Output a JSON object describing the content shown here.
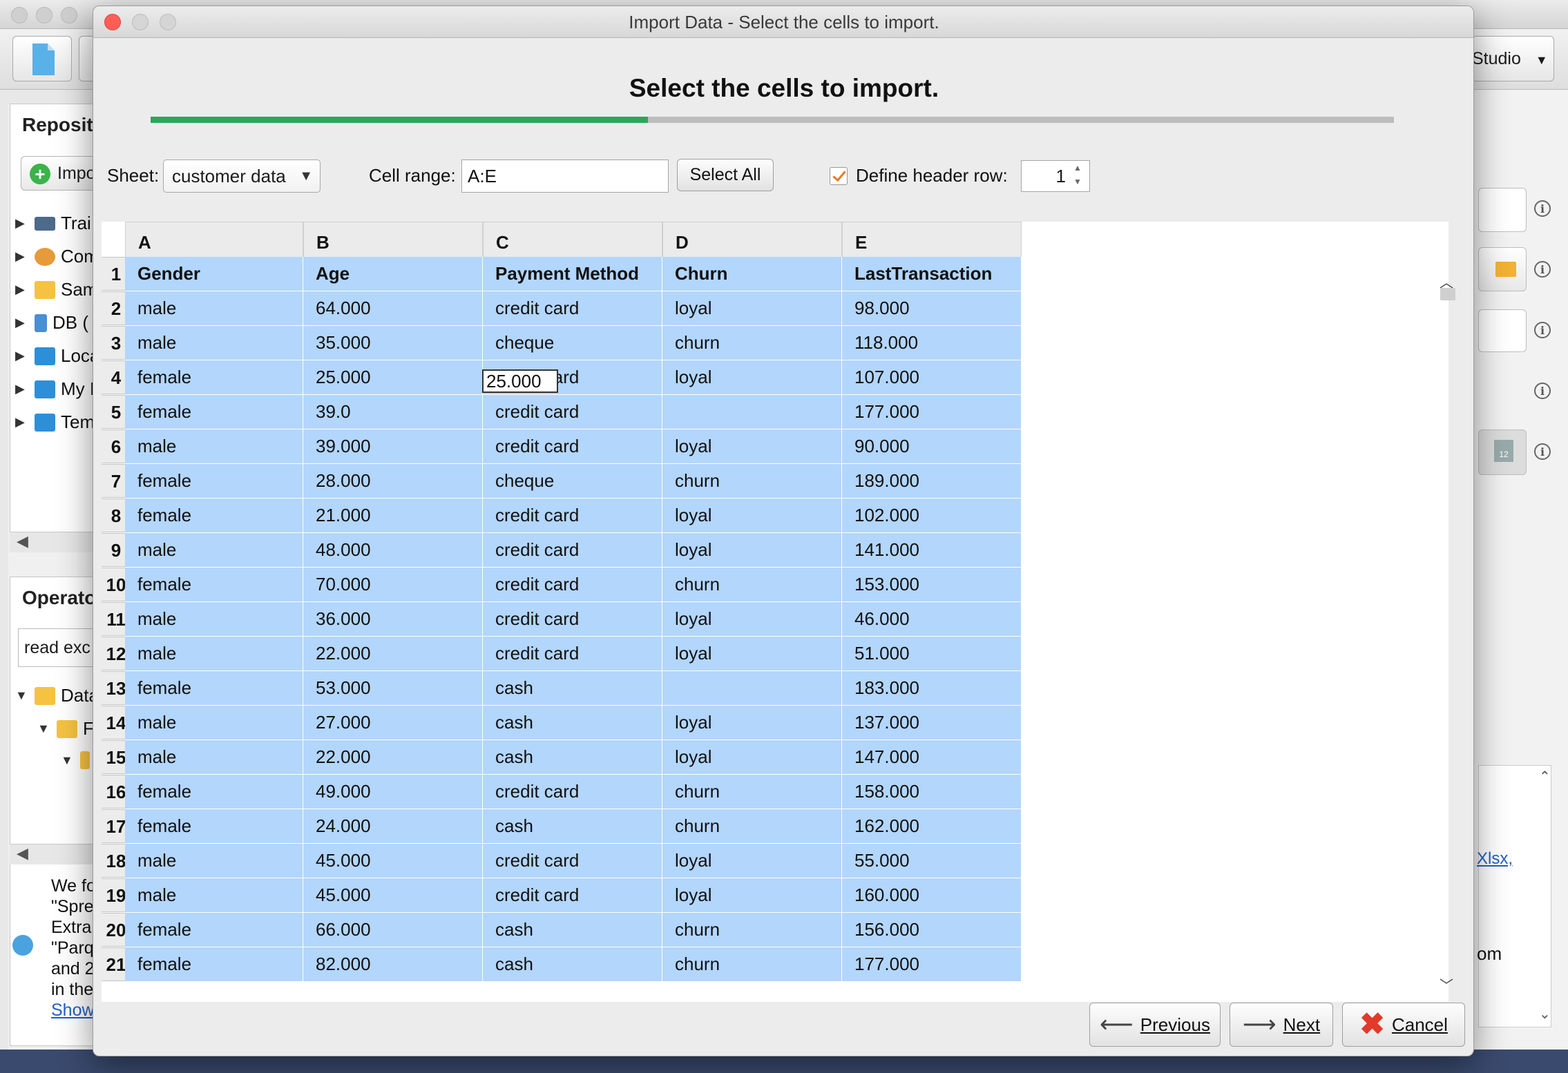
{
  "background": {
    "toolbar_right_label": "Studio",
    "repository_title": "Reposit",
    "import_button": "Impo",
    "tree_items": [
      "Trai",
      "Com",
      "Sam",
      "DB (",
      "Loca",
      "My I",
      "Tem"
    ],
    "operators_title": "Operato",
    "operators_search": "read exc",
    "operator_tree": [
      "Data",
      "F",
      ""
    ],
    "help_text": [
      "We fo",
      "\"Spre",
      "Extra",
      "\"Parq",
      "and 2",
      "in the"
    ],
    "help_link": "Show",
    "right_link": "Xlsx,",
    "right_text": "om",
    "calendar_day": "12"
  },
  "dialog": {
    "window_title": "Import Data - Select the cells to import.",
    "heading": "Select the cells to import.",
    "progress_fraction": 0.4,
    "sheet_label": "Sheet:",
    "sheet_value": "customer data",
    "cell_range_label": "Cell range:",
    "cell_range_value": "A:E",
    "select_all_label": "Select All",
    "define_header_label": "Define header row:",
    "header_row_value": "1",
    "previous_label": "Previous",
    "next_label": "Next",
    "cancel_label": "Cancel"
  },
  "grid": {
    "columns": [
      "A",
      "B",
      "C",
      "D",
      "E"
    ],
    "header_row": {
      "num": "1",
      "cells": [
        "Gender",
        "Age",
        "Payment Method",
        "Churn",
        "LastTransaction"
      ]
    },
    "rows": [
      {
        "num": "2",
        "cells": [
          "male",
          "64.000",
          "credit card",
          "loyal",
          "98.000"
        ]
      },
      {
        "num": "3",
        "cells": [
          "male",
          "35.000",
          "cheque",
          "churn",
          "118.000"
        ]
      },
      {
        "num": "4",
        "cells": [
          "female",
          "25.000",
          "credit card",
          "loyal",
          "107.000"
        ]
      },
      {
        "num": "5",
        "cells": [
          "female",
          "39.0",
          "credit card",
          "",
          "177.000"
        ]
      },
      {
        "num": "6",
        "cells": [
          "male",
          "39.000",
          "credit card",
          "loyal",
          "90.000"
        ]
      },
      {
        "num": "7",
        "cells": [
          "female",
          "28.000",
          "cheque",
          "churn",
          "189.000"
        ]
      },
      {
        "num": "8",
        "cells": [
          "female",
          "21.000",
          "credit card",
          "loyal",
          "102.000"
        ]
      },
      {
        "num": "9",
        "cells": [
          "male",
          "48.000",
          "credit card",
          "loyal",
          "141.000"
        ]
      },
      {
        "num": "10",
        "cells": [
          "female",
          "70.000",
          "credit card",
          "churn",
          "153.000"
        ]
      },
      {
        "num": "11",
        "cells": [
          "male",
          "36.000",
          "credit card",
          "loyal",
          "46.000"
        ]
      },
      {
        "num": "12",
        "cells": [
          "male",
          "22.000",
          "credit card",
          "loyal",
          "51.000"
        ]
      },
      {
        "num": "13",
        "cells": [
          "female",
          "53.000",
          "cash",
          "",
          "183.000"
        ]
      },
      {
        "num": "14",
        "cells": [
          "male",
          "27.000",
          "cash",
          "loyal",
          "137.000"
        ]
      },
      {
        "num": "15",
        "cells": [
          "male",
          "22.000",
          "cash",
          "loyal",
          "147.000"
        ]
      },
      {
        "num": "16",
        "cells": [
          "female",
          "49.000",
          "credit card",
          "churn",
          "158.000"
        ]
      },
      {
        "num": "17",
        "cells": [
          "female",
          "24.000",
          "cash",
          "churn",
          "162.000"
        ]
      },
      {
        "num": "18",
        "cells": [
          "male",
          "45.000",
          "credit card",
          "loyal",
          "55.000"
        ]
      },
      {
        "num": "19",
        "cells": [
          "male",
          "45.000",
          "credit card",
          "loyal",
          "160.000"
        ]
      },
      {
        "num": "20",
        "cells": [
          "female",
          "66.000",
          "cash",
          "churn",
          "156.000"
        ]
      },
      {
        "num": "21",
        "cells": [
          "female",
          "82.000",
          "cash",
          "churn",
          "177.000"
        ]
      }
    ],
    "editor_value": "25.000"
  },
  "colors": {
    "selection": "#b3d6fc",
    "progress": "#2ea55b",
    "close": "#fd5f57"
  }
}
